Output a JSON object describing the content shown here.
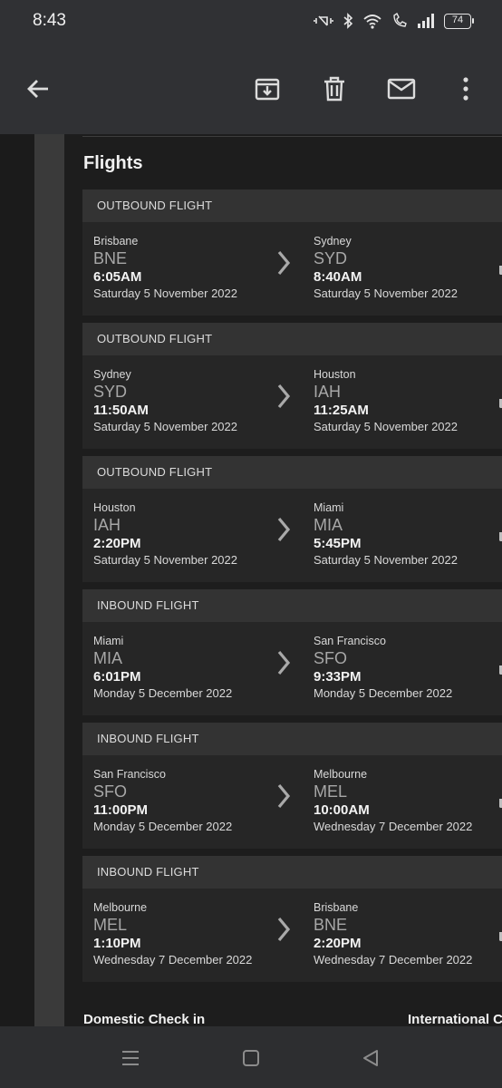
{
  "status_bar": {
    "time": "8:43",
    "battery": "74"
  },
  "app_bar": {
    "back_icon": "arrow-back-icon",
    "archive_icon": "archive-icon",
    "delete_icon": "trash-icon",
    "mark_unread_icon": "mail-icon",
    "more_icon": "more-vertical-icon"
  },
  "email": {
    "section_title": "Flights",
    "flights": [
      {
        "header": "OUTBOUND FLIGHT",
        "from": {
          "city": "Brisbane",
          "code": "BNE",
          "time": "6:05AM",
          "date": "Saturday 5 November 2022"
        },
        "to": {
          "city": "Sydney",
          "code": "SYD",
          "time": "8:40AM",
          "date": "Saturday 5 November 2022"
        }
      },
      {
        "header": "OUTBOUND FLIGHT",
        "from": {
          "city": "Sydney",
          "code": "SYD",
          "time": "11:50AM",
          "date": "Saturday 5 November 2022"
        },
        "to": {
          "city": "Houston",
          "code": "IAH",
          "time": "11:25AM",
          "date": "Saturday 5 November 2022"
        }
      },
      {
        "header": "OUTBOUND FLIGHT",
        "from": {
          "city": "Houston",
          "code": "IAH",
          "time": "2:20PM",
          "date": "Saturday 5 November 2022"
        },
        "to": {
          "city": "Miami",
          "code": "MIA",
          "time": "5:45PM",
          "date": "Saturday 5 November 2022"
        }
      },
      {
        "header": "INBOUND FLIGHT",
        "from": {
          "city": "Miami",
          "code": "MIA",
          "time": "6:01PM",
          "date": "Monday 5 December 2022"
        },
        "to": {
          "city": "San Francisco",
          "code": "SFO",
          "time": "9:33PM",
          "date": "Monday 5 December 2022"
        }
      },
      {
        "header": "INBOUND FLIGHT",
        "from": {
          "city": "San Francisco",
          "code": "SFO",
          "time": "11:00PM",
          "date": "Monday 5 December 2022"
        },
        "to": {
          "city": "Melbourne",
          "code": "MEL",
          "time": "10:00AM",
          "date": "Wednesday 7 December 2022"
        }
      },
      {
        "header": "INBOUND FLIGHT",
        "from": {
          "city": "Melbourne",
          "code": "MEL",
          "time": "1:10PM",
          "date": "Wednesday 7 December 2022"
        },
        "to": {
          "city": "Brisbane",
          "code": "BNE",
          "time": "2:20PM",
          "date": "Wednesday 7 December 2022"
        }
      }
    ],
    "domestic_checkin_title": "Domestic Check in",
    "international_checkin_title": "International C"
  },
  "colors": {
    "app_bar": "#303134",
    "card": "#262626",
    "card_header": "#333333",
    "background": "#1d1d1d"
  }
}
